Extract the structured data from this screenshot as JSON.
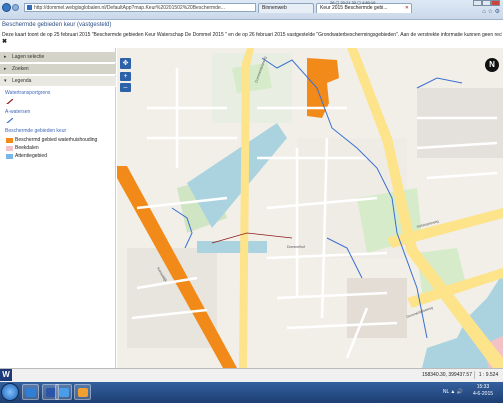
{
  "browser": {
    "address": "http://dommel.webgisglobalen.nl/DefaultApp?map.Keur%20201502%20Beschermde...",
    "tabs": [
      {
        "label": "Binnenweb"
      },
      {
        "label": "Keur 2015 Beschermde gebi..."
      }
    ],
    "system_status": "26 ▢ 20:21 33 ▢ 4:80:10",
    "colors": {
      "chrome": "#c9d8ea",
      "accent": "#3b78c2"
    }
  },
  "page": {
    "title": "Beschermde gebieden keur (vastgesteld)",
    "subtitle": "Deze kaart toont de op 25 februari 2015 \"Beschermde gebieden Keur Waterschap De Dommel 2015 \" en de op 26 februari 2015 vastgestelde \"Grondwaterbeschermingsgebieden\". Aan de verstrekte informatie kunnen geen rechten worden ontleend.",
    "close_symbol": "✖"
  },
  "sidebar": {
    "accordion": [
      {
        "label": "Lagen selectie",
        "arrow": "▸"
      },
      {
        "label": "Zoeken",
        "arrow": "▸"
      },
      {
        "label": "Legenda",
        "arrow": "▾"
      }
    ],
    "legend": [
      {
        "heading": "Watertransportgrens",
        "items": [
          {
            "symbol": "line",
            "color": "#8b1a1a",
            "label": ""
          }
        ]
      },
      {
        "heading": "A-watersen",
        "items": [
          {
            "symbol": "line",
            "color": "#3b6fd1",
            "label": ""
          }
        ]
      },
      {
        "heading": "Beschermde gebieden keur",
        "items": [
          {
            "symbol": "fill",
            "color": "#f28a1a",
            "label": "Beschermd gebied waterhuishouding"
          },
          {
            "symbol": "fill",
            "color": "#f3c2c6",
            "label": "Beekdalen"
          },
          {
            "symbol": "fill",
            "color": "#7ab6e6",
            "label": "Attentiegebied"
          }
        ]
      }
    ]
  },
  "map": {
    "controls": [
      "✥",
      "+",
      "–"
    ],
    "north_label": "N",
    "coordinates": "158340.30, 399437.57",
    "scale": "1 : 9.524",
    "street_labels": [
      "Dommeldalseweg",
      "Dommelhof",
      "Geldropseweg",
      "Dommeldalseweg",
      "Kanaaldijk"
    ],
    "colors": {
      "orange": "#f28a1a",
      "road_yellow": "#fde38a",
      "water": "#aad3df",
      "background": "#f2efe9",
      "river": "#3b6fd1"
    }
  },
  "taskbar": {
    "apps": [
      "ie-icon",
      "word-icon",
      "ie-icon",
      "paint-icon"
    ],
    "tray": "NL ▲ 🔊",
    "time": "15:33",
    "date": "4-6-2015"
  }
}
